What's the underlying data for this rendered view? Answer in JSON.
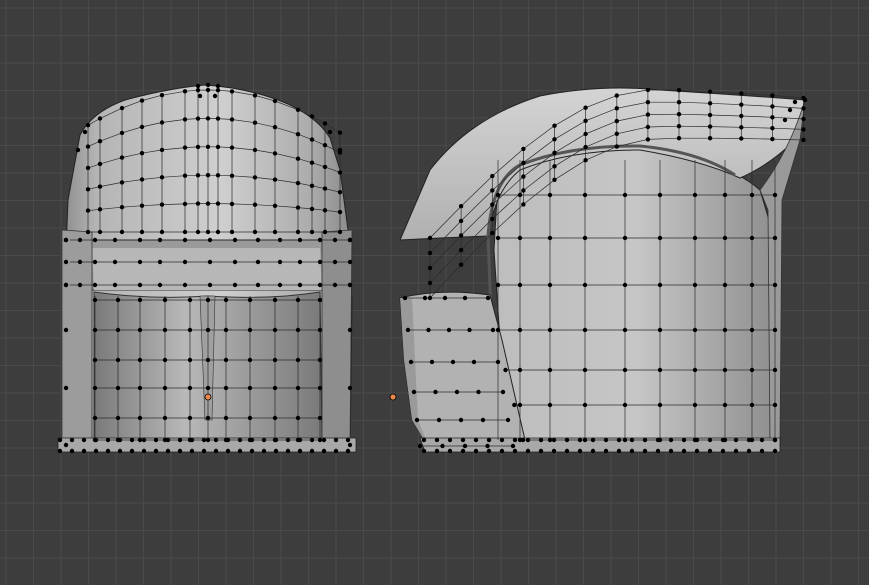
{
  "viewport": {
    "background": "#3d3d3d",
    "grid_color": "#4a4a4a",
    "object_origin_color": "#e8884a",
    "vertex_color": "#000000",
    "shading": "solid"
  },
  "objects": [
    {
      "name": "helmet-front-view"
    },
    {
      "name": "helmet-side-view"
    }
  ]
}
